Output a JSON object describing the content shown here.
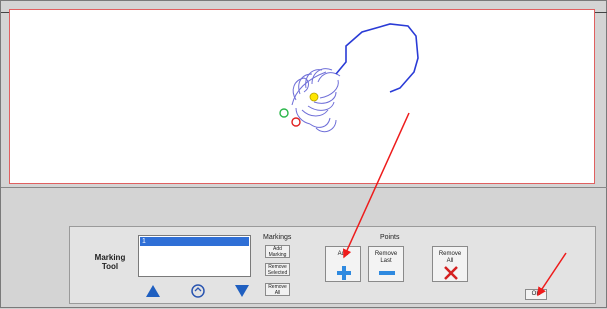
{
  "tool": {
    "label_line1": "Marking",
    "label_line2": "Tool"
  },
  "markings": {
    "title": "Markings",
    "list_items": [
      "1"
    ],
    "buttons": {
      "add": "Add Marking",
      "remove_selected": "Remove Selected",
      "remove_all": "Remove All"
    }
  },
  "points": {
    "title": "Points",
    "add": "Add",
    "remove_last_line1": "Remove",
    "remove_last_line2": "Last",
    "remove_all_line1": "Remove",
    "remove_all_line2": "All"
  },
  "footer": {
    "ok": "OK"
  },
  "colors": {
    "canvas_border": "#e06060",
    "path_blue": "#2a3bd6",
    "annotation_red": "#ee1c1c",
    "selection_blue": "#2f6fd6"
  },
  "icons": {
    "up": "up-arrow-icon",
    "swap": "swap-icon",
    "down": "down-arrow-icon",
    "plus": "plus-icon",
    "minus": "minus-icon",
    "remove": "x-icon"
  }
}
